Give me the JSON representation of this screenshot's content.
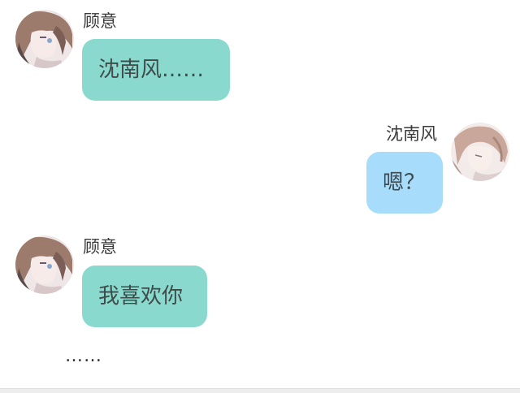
{
  "chat": {
    "messages": [
      {
        "sender": "顾意",
        "text": "沈南风……",
        "side": "left",
        "bubble_color": "#8ad9cf"
      },
      {
        "sender": "沈南风",
        "text": "嗯？",
        "side": "right",
        "bubble_color": "#a7dcfb"
      },
      {
        "sender": "顾意",
        "text": "我喜欢你",
        "side": "left",
        "bubble_color": "#8ad9cf"
      }
    ],
    "narration": "……"
  },
  "colors": {
    "teal_bubble": "#8ad9cf",
    "blue_bubble": "#a7dcfb"
  }
}
